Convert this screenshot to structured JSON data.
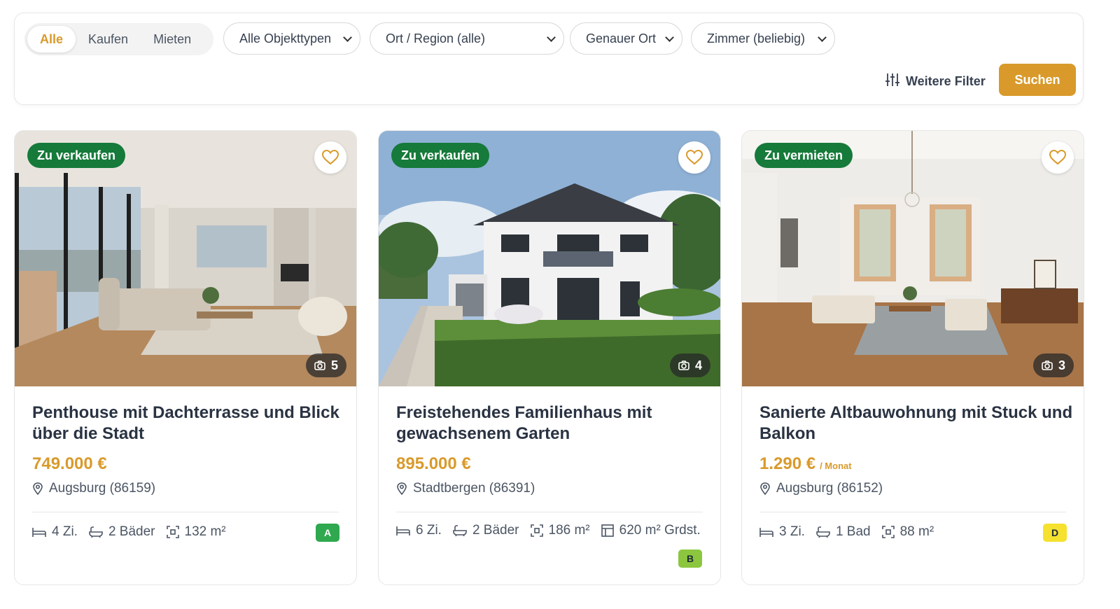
{
  "filters": {
    "segments": [
      "Alle",
      "Kaufen",
      "Mieten"
    ],
    "active_segment": "Alle",
    "object_type": "Alle Objekttypen",
    "region": "Ort / Region (alle)",
    "exact_location": "Genauer Ort",
    "rooms": "Zimmer (beliebig)",
    "more_filters_label": "Weitere Filter",
    "search_label": "Suchen"
  },
  "colors": {
    "accent": "#d99a2b",
    "badge_green": "#167a3a",
    "energy_A": "#2fa84f",
    "energy_B": "#8cc63f",
    "energy_D": "#f5e12e"
  },
  "listings": [
    {
      "badge": "Zu verkaufen",
      "photo_count": "5",
      "title": "Penthouse mit Dachterrasse und Blick über die Stadt",
      "price": "749.000 €",
      "price_suffix": "",
      "location": "Augsburg (86159)",
      "rooms": "4 Zi.",
      "baths": "2 Bäder",
      "area": "132 m²",
      "plot": "",
      "energy_class": "A"
    },
    {
      "badge": "Zu verkaufen",
      "photo_count": "4",
      "title": "Freistehendes Familienhaus mit gewachsenem Garten",
      "price": "895.000 €",
      "price_suffix": "",
      "location": "Stadtbergen (86391)",
      "rooms": "6 Zi.",
      "baths": "2 Bäder",
      "area": "186 m²",
      "plot": "620 m² Grdst.",
      "energy_class": "B"
    },
    {
      "badge": "Zu vermieten",
      "photo_count": "3",
      "title": "Sanierte Altbauwohnung mit Stuck und Balkon",
      "price": "1.290 €",
      "price_suffix": "/ Monat",
      "location": "Augsburg (86152)",
      "rooms": "3 Zi.",
      "baths": "1 Bad",
      "area": "88 m²",
      "plot": "",
      "energy_class": "D"
    }
  ],
  "icons": [
    "sliders-icon",
    "heart-icon",
    "camera-icon",
    "map-pin-icon",
    "bed-icon",
    "bath-icon",
    "area-icon",
    "plot-icon"
  ]
}
